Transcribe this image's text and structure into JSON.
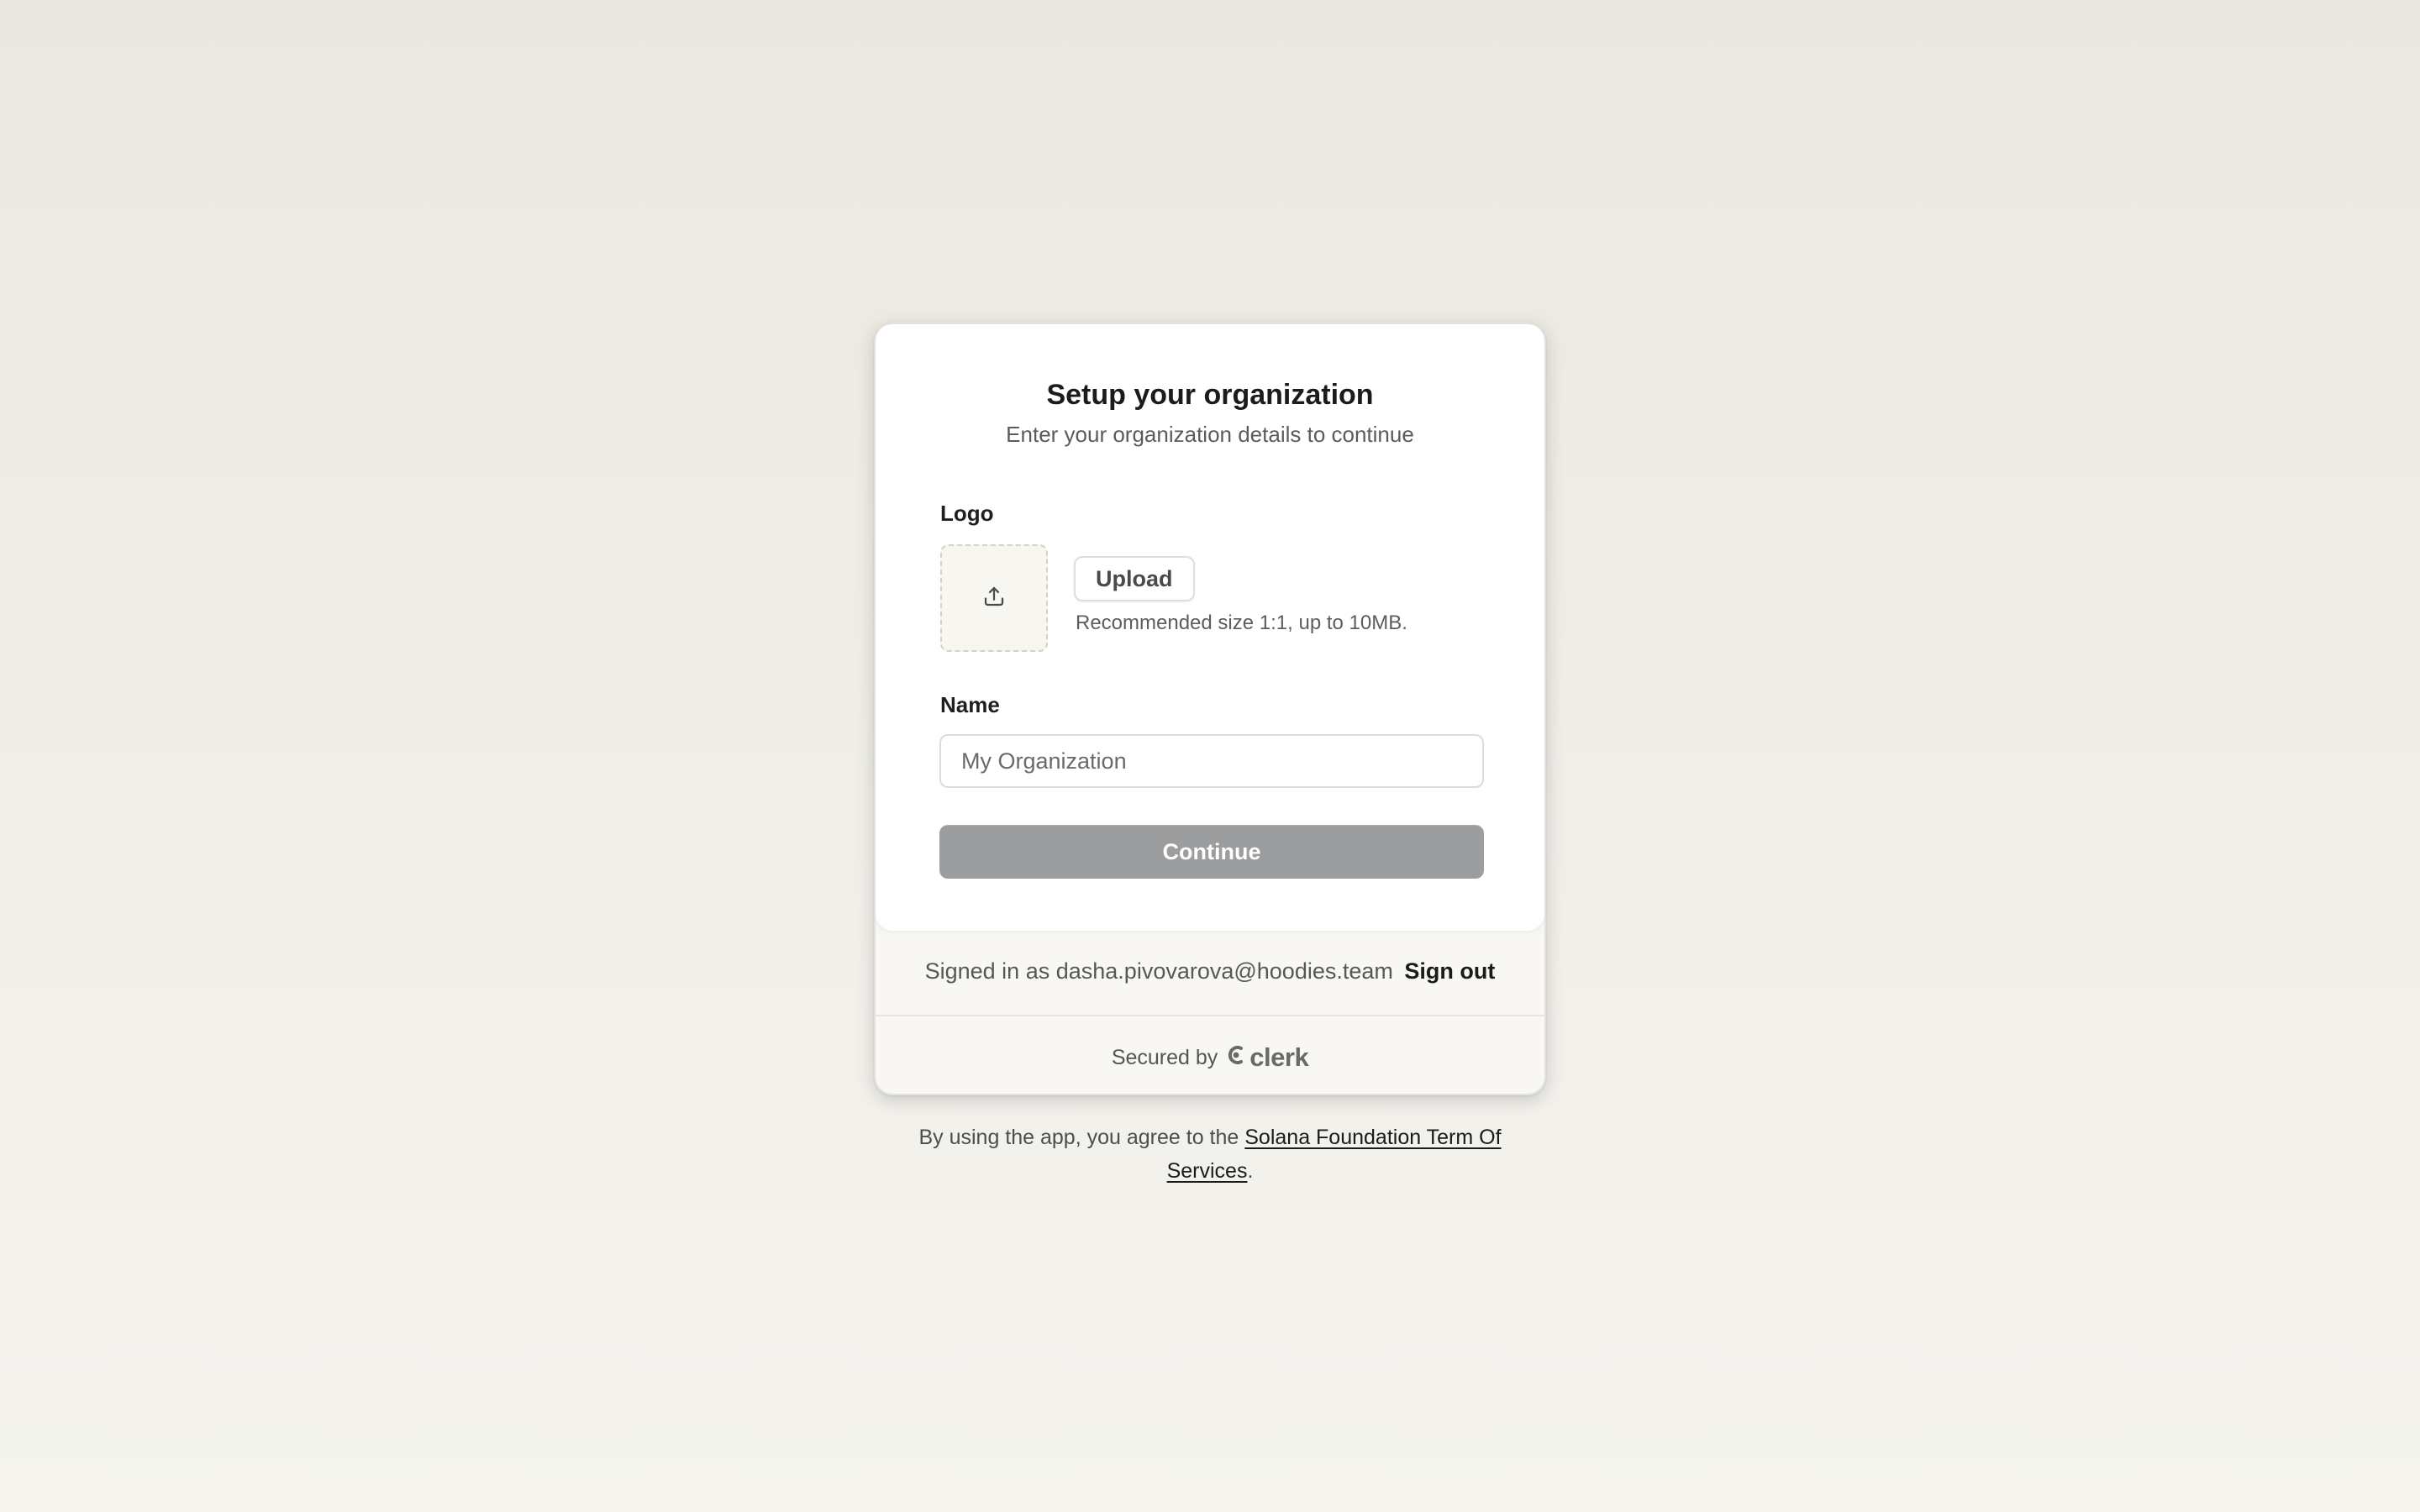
{
  "card": {
    "title": "Setup your organization",
    "subtitle": "Enter your organization details to continue"
  },
  "logo": {
    "label": "Logo",
    "upload_icon": "upload-icon",
    "upload_button_label": "Upload",
    "hint": "Recommended size 1:1, up to 10MB."
  },
  "name": {
    "label": "Name",
    "value": "",
    "placeholder": "My Organization"
  },
  "continue_button_label": "Continue",
  "footer": {
    "signed_in_prefix": "Signed in as",
    "email": "dasha.pivovarova@hoodies.team",
    "sign_out_label": "Sign out",
    "secured_by": "Secured by",
    "brand": "clerk",
    "brand_icon": "clerk-logo-icon"
  },
  "terms": {
    "prefix": "By using the app, you agree to the",
    "link_text": "Solana Foundation Term Of Services",
    "suffix": "."
  },
  "colors": {
    "background": "#ECE9E2",
    "card": "#FFFFFF",
    "card_footer": "#F8F7F3",
    "continue_disabled": "#9C9D9F",
    "text_primary": "#1B1B1B",
    "text_secondary": "#5B5B5B"
  }
}
